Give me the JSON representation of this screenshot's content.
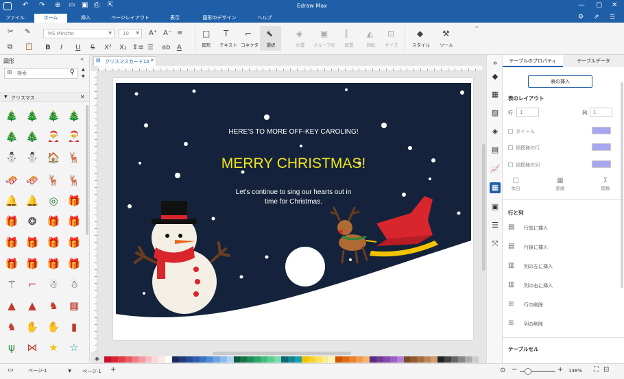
{
  "app": {
    "title": "Edraw Max"
  },
  "menu": {
    "items": [
      "ファイル",
      "ホーム",
      "挿入",
      "ページレイアウト",
      "表示",
      "図形のデザイン",
      "ヘルプ"
    ],
    "active": 1
  },
  "ribbon": {
    "font_name": "MS Mincho",
    "font_size": "10",
    "tools": [
      "図形",
      "テキスト",
      "コネクタ",
      "選択",
      "位置",
      "グループ化",
      "配置",
      "回転",
      "サイズ",
      "スタイル",
      "ツール"
    ]
  },
  "library": {
    "title": "図形",
    "search_placeholder": "検索",
    "category": "クリスマス"
  },
  "tab": {
    "label": "クリスマスカード10"
  },
  "card": {
    "line1": "HERE'S TO MORE OFF-KEY CAROLING!",
    "title": "MERRY CHRISTMAS!",
    "line2a": "Let's continue to sing our hearts out in",
    "line2b": "time for Christmas.",
    "colors": {
      "bg": "#14233b",
      "title": "#f5e51b",
      "snow": "#ffffff"
    }
  },
  "right_panel": {
    "tabs": [
      "テーブルのプロパティ",
      "テーブルデータ"
    ],
    "insert_button": "表の挿入",
    "layout_title": "表のレイアウト",
    "row_label": "行",
    "row_value": "1",
    "col_label": "列",
    "col_value": "1",
    "checks": [
      "タイトル",
      "縞模様の行",
      "縞模様の列"
    ],
    "mini": [
      "余白",
      "罫線",
      "関数"
    ],
    "rows_cols_title": "行と列",
    "actions": [
      "行前に挿入",
      "行後に挿入",
      "列の左に挿入",
      "列の右に挿入",
      "行の削除",
      "列の削除"
    ],
    "cell_title": "テーブルセル",
    "swatch_color": "#a7a7f0"
  },
  "status": {
    "page_select": "ページ-1",
    "page_tab": "ページ-1",
    "zoom": "138%"
  },
  "palette": [
    "#c8102e",
    "#d9242f",
    "#e33b45",
    "#ea5a63",
    "#f07b82",
    "#f49aa0",
    "#f8bcc0",
    "#fbd8da",
    "#fde9ea",
    "#ffffff",
    "#1a2a5e",
    "#203a7a",
    "#274c96",
    "#2f5fae",
    "#3a74c4",
    "#4d8bd6",
    "#69a4e3",
    "#8bbcec",
    "#aed2f3",
    "#0e5b3b",
    "#167449",
    "#1f8c58",
    "#2aa467",
    "#3fbb7a",
    "#5ccd90",
    "#80dba9",
    "#0b6a75",
    "#10848f",
    "#17a0aa",
    "#f2c300",
    "#f6d32a",
    "#f9e15a",
    "#fbeb8a",
    "#fdf3b8",
    "#d35400",
    "#e06a14",
    "#ea822d",
    "#f29a4b",
    "#f7b26d",
    "#5b2c83",
    "#6f3a9a",
    "#844ab0",
    "#9b60c4",
    "#b27fd4",
    "#7a4a24",
    "#8f5a30",
    "#a56d3e",
    "#bb8453",
    "#d09d6e",
    "#222222",
    "#444444",
    "#666666",
    "#888888",
    "#aaaaaa",
    "#cccccc"
  ]
}
